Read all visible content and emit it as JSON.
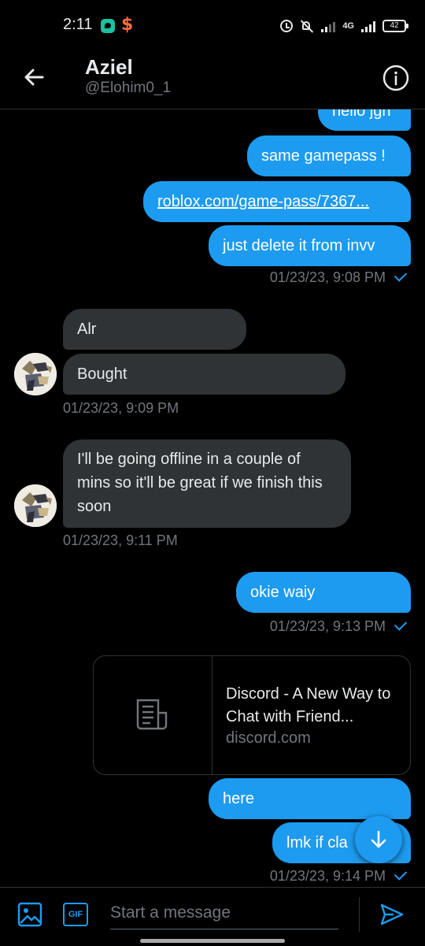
{
  "status_bar": {
    "time": "2:11",
    "network": "4G",
    "battery": "42"
  },
  "header": {
    "name": "Aziel",
    "handle": "@Elohim0_1"
  },
  "messages": {
    "m0": "hello jgh",
    "m1": "same gamepass !",
    "m2": "roblox.com/game-pass/7367...",
    "m3": "just delete it from invv",
    "ts1": "01/23/23, 9:08 PM",
    "m4": "Alr",
    "m5": "Bought",
    "ts2": "01/23/23, 9:09 PM",
    "m6": "I'll be going offline in a couple of mins so it'll be great if we finish this soon",
    "ts3": "01/23/23, 9:11 PM",
    "m7": "okie waiy",
    "ts4": "01/23/23, 9:13 PM",
    "m8": "here",
    "m9": "lmk if cla",
    "ts5": "01/23/23, 9:14 PM"
  },
  "link_card": {
    "title": "Discord - A New Way to Chat with Friend...",
    "domain": "discord.com"
  },
  "composer": {
    "gif_label": "GIF",
    "placeholder": "Start a message"
  },
  "colors": {
    "accent": "#1d9bf0",
    "incoming_bubble": "#2f3336",
    "background": "#000000"
  }
}
